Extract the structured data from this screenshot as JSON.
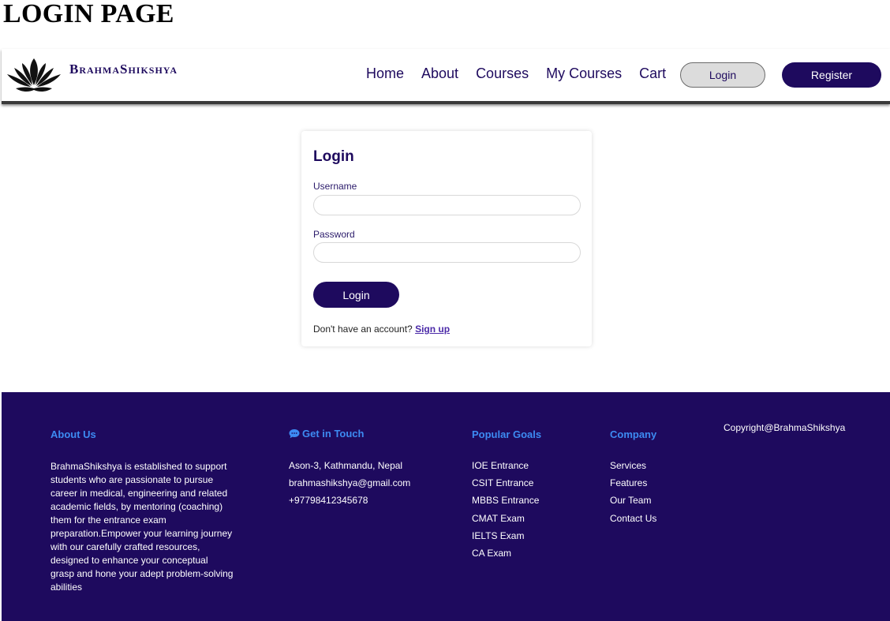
{
  "page_heading": "LOGIN PAGE",
  "brand": {
    "name": "BrahmaShikshya"
  },
  "nav": {
    "links": [
      "Home",
      "About",
      "Courses",
      "My Courses",
      "Cart"
    ],
    "login_label": "Login",
    "register_label": "Register"
  },
  "login_form": {
    "title": "Login",
    "username_label": "Username",
    "username_value": "",
    "password_label": "Password",
    "password_value": "",
    "submit_label": "Login",
    "no_account_text": "Don't have an account?",
    "signup_label": "Sign up"
  },
  "footer": {
    "about": {
      "heading": "About Us",
      "text": "BrahmaShikshya is established to support students who are passionate to pursue career in medical, engineering and related academic fields, by mentoring (coaching) them for the entrance exam preparation.Empower your learning journey with our carefully crafted resources, designed to enhance your conceptual grasp and hone your adept problem-solving abilities"
    },
    "contact": {
      "heading": "Get in Touch",
      "icon": "chat-bubble-icon",
      "items": [
        "Ason-3, Kathmandu, Nepal",
        "brahmashikshya@gmail.com",
        "+97798412345678"
      ]
    },
    "goals": {
      "heading": "Popular Goals",
      "items": [
        "IOE Entrance",
        "CSIT Entrance",
        "MBBS Entrance",
        "CMAT Exam",
        "IELTS Exam",
        "CA Exam"
      ]
    },
    "company": {
      "heading": "Company",
      "items": [
        "Services",
        "Features",
        "Our Team",
        "Contact Us"
      ]
    },
    "copyright": "Copyright@BrahmaShikshya"
  },
  "colors": {
    "primary": "#1e0a5e",
    "footer_heading": "#3d8bf2",
    "nav_login_bg": "#dcdcdc"
  }
}
